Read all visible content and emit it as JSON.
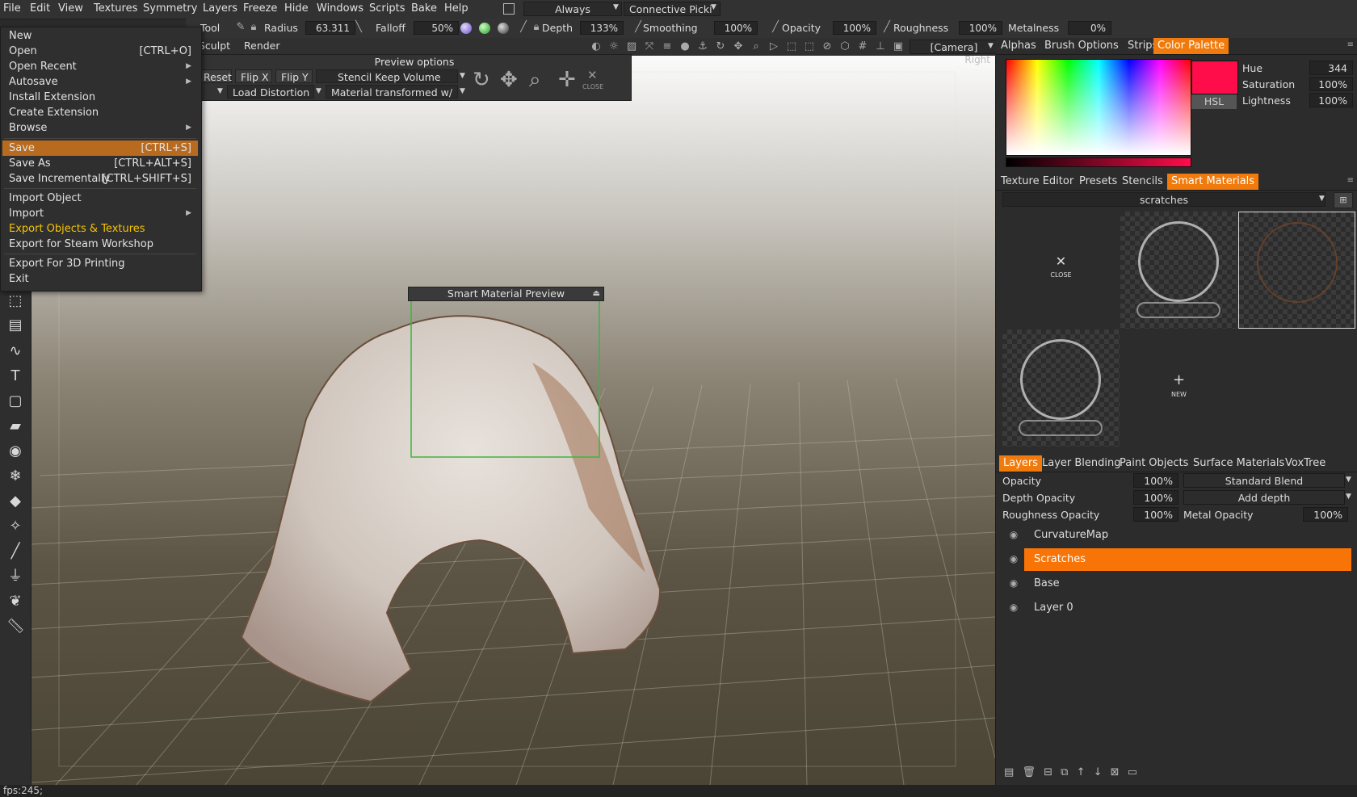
{
  "menubar": {
    "items": [
      "File",
      "Edit",
      "View",
      "Textures",
      "Symmetry",
      "Layers",
      "Freeze",
      "Hide",
      "Windows",
      "Scripts",
      "Bake",
      "Help"
    ],
    "combo_always": "Always",
    "combo_connective": "Connective Picki"
  },
  "toolbar": {
    "tool_label": "Tool",
    "radius_label": "Radius",
    "radius_value": "63.311",
    "falloff_label": "Falloff",
    "falloff_value": "50%",
    "depth_label": "Depth",
    "depth_value": "133%",
    "smoothing_label": "Smoothing",
    "smoothing_value": "100%",
    "opacity_label": "Opacity",
    "opacity_value": "100%",
    "roughness_label": "Roughness",
    "roughness_value": "100%",
    "metalness_label": "Metalness",
    "metalness_value": "0%",
    "sculpt_label": "Sculpt",
    "render_label": "Render",
    "camera_value": "[Camera]",
    "view_label": "Right"
  },
  "file_menu": {
    "items": [
      {
        "label": "New",
        "shortcut": "",
        "arrow": false
      },
      {
        "label": "Open",
        "shortcut": "[CTRL+O]",
        "arrow": false
      },
      {
        "label": "Open Recent",
        "shortcut": "",
        "arrow": true
      },
      {
        "label": "Autosave",
        "shortcut": "",
        "arrow": true
      },
      {
        "label": "Install Extension",
        "shortcut": "",
        "arrow": false
      },
      {
        "label": "Create Extension",
        "shortcut": "",
        "arrow": false
      },
      {
        "label": "Browse",
        "shortcut": "",
        "arrow": true
      },
      {
        "label": "Save",
        "shortcut": "[CTRL+S]",
        "arrow": false
      },
      {
        "label": "Save As",
        "shortcut": "[CTRL+ALT+S]",
        "arrow": false
      },
      {
        "label": "Save Incrementally",
        "shortcut": "[CTRL+SHIFT+S]",
        "arrow": false
      },
      {
        "label": "Import Object",
        "shortcut": "",
        "arrow": false
      },
      {
        "label": "Import",
        "shortcut": "",
        "arrow": true
      },
      {
        "label": "Export Objects & Textures",
        "shortcut": "",
        "arrow": false
      },
      {
        "label": "Export for Steam Workshop",
        "shortcut": "",
        "arrow": false
      },
      {
        "label": "Export For 3D Printing",
        "shortcut": "",
        "arrow": false
      },
      {
        "label": "Exit",
        "shortcut": "",
        "arrow": false
      }
    ]
  },
  "preview_options": {
    "title": "Preview options",
    "reset": "Reset",
    "flip_x": "Flip X",
    "flip_y": "Flip Y",
    "stencil": "Stencil Keep Volume",
    "load_distortion": "Load Distortion",
    "material_transformed": "Material transformed w/",
    "close": "CLOSE"
  },
  "smart_material_preview": {
    "title": "Smart Material Preview"
  },
  "color_panel": {
    "tabs": [
      "Alphas",
      "Brush Options",
      "Strips",
      "Color Palette"
    ],
    "active_tab": "Color Palette",
    "hue_label": "Hue",
    "hue_value": "344",
    "saturation_label": "Saturation",
    "saturation_value": "100%",
    "lightness_label": "Lightness",
    "lightness_value": "100%",
    "mode_button": "HSL",
    "swatch_color": "#ff0d4a"
  },
  "materials_panel": {
    "tabs": [
      "Texture Editor",
      "Presets",
      "Stencils",
      "Smart Materials"
    ],
    "active_tab": "Smart Materials",
    "folder": "scratches",
    "close_label": "CLOSE",
    "new_label": "NEW"
  },
  "layers_panel": {
    "tabs": [
      "Layers",
      "Layer Blending",
      "Paint Objects",
      "Surface Materials",
      "VoxTree"
    ],
    "active_tab": "Layers",
    "opacity_label": "Opacity",
    "opacity_value": "100%",
    "blend_mode": "Standard Blend",
    "depth_opacity_label": "Depth Opacity",
    "depth_opacity_value": "100%",
    "depth_mode": "Add depth",
    "roughness_opacity_label": "Roughness Opacity",
    "roughness_opacity_value": "100%",
    "metal_opacity_label": "Metal Opacity",
    "metal_opacity_value": "100%",
    "layers": [
      {
        "name": "CurvatureMap",
        "selected": false
      },
      {
        "name": "Scratches",
        "selected": true
      },
      {
        "name": "Base",
        "selected": false
      },
      {
        "name": "Layer 0",
        "selected": false
      }
    ]
  },
  "status": {
    "fps": "fps:245;"
  },
  "colors": {
    "accent": "#f07a0c",
    "selected_layer": "#f97406",
    "menu_highlight": "#b86a1e",
    "highlight_text": "#f5c400"
  }
}
